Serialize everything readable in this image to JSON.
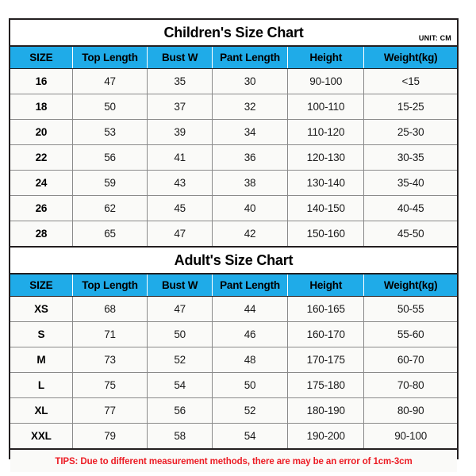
{
  "meta": {
    "accent_blue": "#1fabe8",
    "tips_red": "#ec1c24",
    "border_dark": "#231f20",
    "row_bg": "#fafaf8"
  },
  "columns": [
    "SIZE",
    "Top Length",
    "Bust W",
    "Pant Length",
    "Height",
    "Weight(kg)"
  ],
  "children": {
    "title": "Children's Size Chart",
    "unit": "UNIT: CM",
    "headers": [
      "SIZE",
      "Top Length",
      "Bust W",
      "Pant Length",
      "Height",
      "Weight(kg)"
    ],
    "rows": [
      [
        "16",
        "47",
        "35",
        "30",
        "90-100",
        "<15"
      ],
      [
        "18",
        "50",
        "37",
        "32",
        "100-110",
        "15-25"
      ],
      [
        "20",
        "53",
        "39",
        "34",
        "110-120",
        "25-30"
      ],
      [
        "22",
        "56",
        "41",
        "36",
        "120-130",
        "30-35"
      ],
      [
        "24",
        "59",
        "43",
        "38",
        "130-140",
        "35-40"
      ],
      [
        "26",
        "62",
        "45",
        "40",
        "140-150",
        "40-45"
      ],
      [
        "28",
        "65",
        "47",
        "42",
        "150-160",
        "45-50"
      ]
    ]
  },
  "adult": {
    "title": "Adult's Size Chart",
    "headers": [
      "SIZE",
      "Top Length",
      "Bust W",
      "Pant Length",
      "Height",
      "Weight(kg)"
    ],
    "rows": [
      [
        "XS",
        "68",
        "47",
        "44",
        "160-165",
        "50-55"
      ],
      [
        "S",
        "71",
        "50",
        "46",
        "160-170",
        "55-60"
      ],
      [
        "M",
        "73",
        "52",
        "48",
        "170-175",
        "60-70"
      ],
      [
        "L",
        "75",
        "54",
        "50",
        "175-180",
        "70-80"
      ],
      [
        "XL",
        "77",
        "56",
        "52",
        "180-190",
        "80-90"
      ],
      [
        "XXL",
        "79",
        "58",
        "54",
        "190-200",
        "90-100"
      ]
    ]
  },
  "tips": "TIPS: Due to different measurement methods, there are may be an error of 1cm-3cm"
}
